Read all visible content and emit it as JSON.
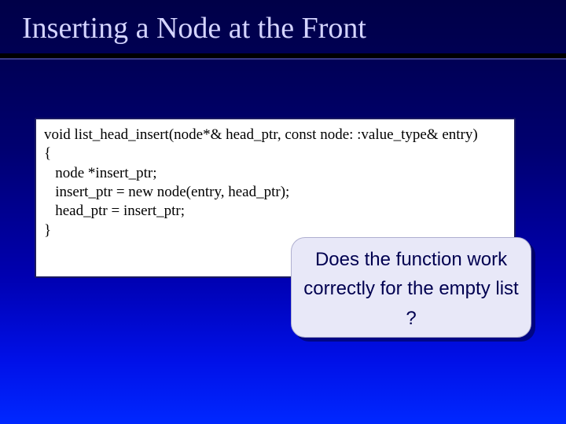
{
  "title": "Inserting a Node at the Front",
  "code": {
    "l1": "void list_head_insert(node*& head_ptr, const node: :value_type& entry)",
    "l2": "{",
    "l3": "   node *insert_ptr;",
    "l4": "",
    "l5": "   insert_ptr = new node(entry, head_ptr);",
    "l6": "   head_ptr = insert_ptr;",
    "l7": "}"
  },
  "callout": "Does the function work correctly for the empty list ?"
}
